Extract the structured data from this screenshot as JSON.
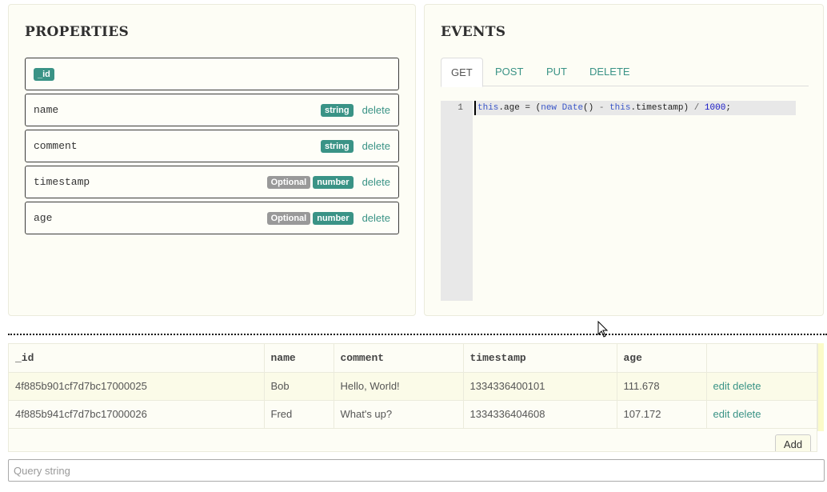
{
  "properties": {
    "title": "PROPERTIES",
    "id_label": "_id",
    "delete_label": "delete",
    "items": [
      {
        "name": "name",
        "optional": "",
        "type": "string"
      },
      {
        "name": "comment",
        "optional": "",
        "type": "string"
      },
      {
        "name": "timestamp",
        "optional": "Optional",
        "type": "number"
      },
      {
        "name": "age",
        "optional": "Optional",
        "type": "number"
      }
    ]
  },
  "events": {
    "title": "EVENTS",
    "tabs": [
      "GET",
      "POST",
      "PUT",
      "DELETE"
    ],
    "active_tab": "GET",
    "editor": {
      "line_number": "1",
      "code": "this.age = (new Date() - this.timestamp) / 1000;"
    }
  },
  "grid": {
    "columns": [
      "_id",
      "name",
      "comment",
      "timestamp",
      "age",
      ""
    ],
    "rows": [
      {
        "_id": "4f885b901cf7d7bc17000025",
        "name": "Bob",
        "comment": "Hello, World!",
        "timestamp": "1334336400101",
        "age": "111.678"
      },
      {
        "_id": "4f885b941cf7d7bc17000026",
        "name": "Fred",
        "comment": "What's up?",
        "timestamp": "1334336404608",
        "age": "107.172"
      }
    ],
    "edit_label": "edit",
    "delete_label": "delete",
    "add_label": "Add"
  },
  "query": {
    "placeholder": "Query string",
    "value": ""
  },
  "colors": {
    "accent": "#3a9386",
    "badge_gray": "#999999",
    "panel_bg": "#fdfdf5"
  }
}
